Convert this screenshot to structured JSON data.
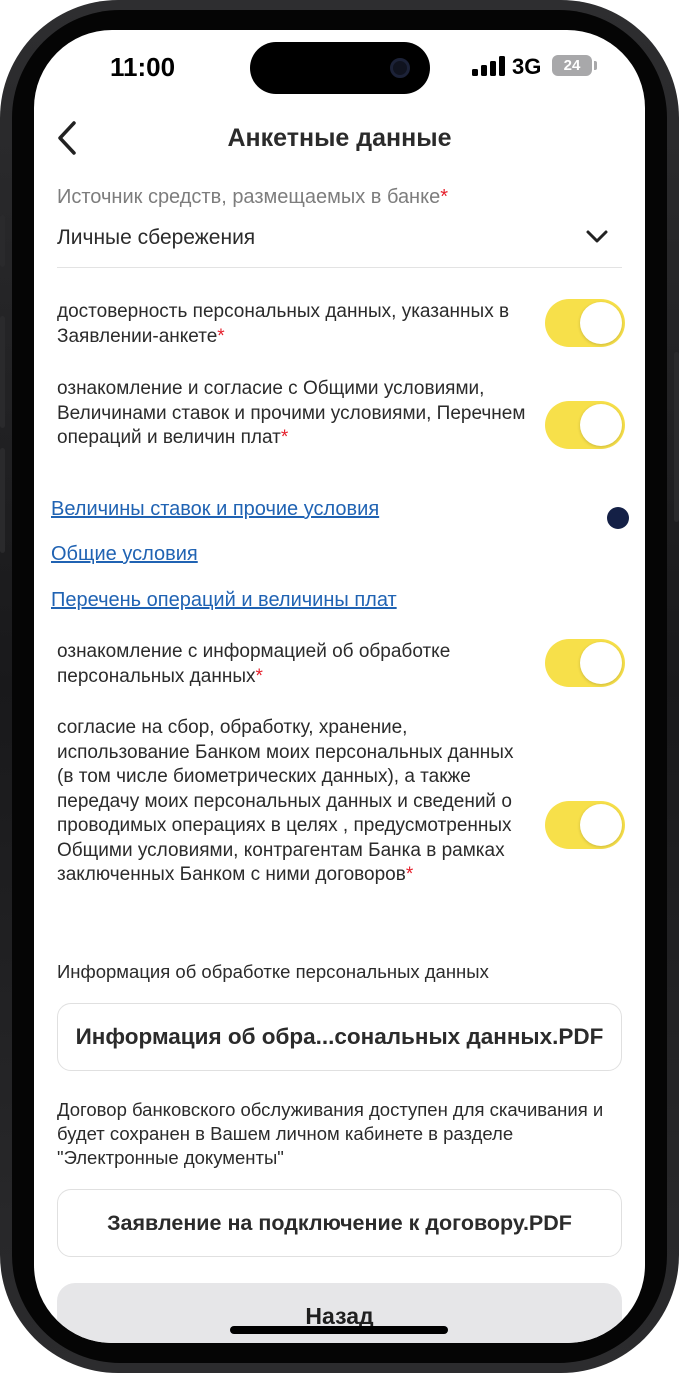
{
  "status_bar": {
    "time": "11:00",
    "network": "3G",
    "battery": "24"
  },
  "header": {
    "title": "Анкетные данные"
  },
  "source_field": {
    "label": "Источник средств, размещаемых в банке",
    "required_mark": "*",
    "value": "Личные сбережения"
  },
  "consents": [
    {
      "text": "достоверность персональных данных, указанных в Заявлении-анкете",
      "required_mark": "*",
      "enabled": true
    },
    {
      "text": "ознакомление и согласие с Общими условиями, Величинами ставок и прочими условиями, Перечнем операций и величин плат",
      "required_mark": "*",
      "enabled": true
    },
    {
      "text": "ознакомление с информацией об обработке персональных данных",
      "required_mark": "*",
      "enabled": true
    },
    {
      "text": "согласие на сбор, обработку, хранение, использование Банком моих персональных данных (в том числе биометрических данных), а также передачу моих персональных данных и сведений  о проводимых операциях в целях , предусмотренных Общими условиями, контрагентам Банка  в рамках заключенных Банком с ними договоров",
      "required_mark": "*",
      "enabled": true
    }
  ],
  "links": [
    "Величины ставок и прочие условия",
    "Общие условия",
    "Перечень операций и величины плат"
  ],
  "personal_data_info": {
    "label": "Информация об обработке персональных данных",
    "file_name": "Информация об обра...сональных данных.PDF"
  },
  "contract_note": "Договор банковского обслуживания доступен для скачивания и будет сохранен в Вашем личном кабинете в разделе \"Электронные документы\"",
  "contract_file": "Заявление на подключение к договору.PDF",
  "footer": {
    "back_label": "Назад"
  },
  "colors": {
    "toggle_on": "#f7e04a",
    "link": "#2063b3",
    "required": "#e5212d",
    "text": "#2b2b2b",
    "hint": "#7d7d7d"
  }
}
